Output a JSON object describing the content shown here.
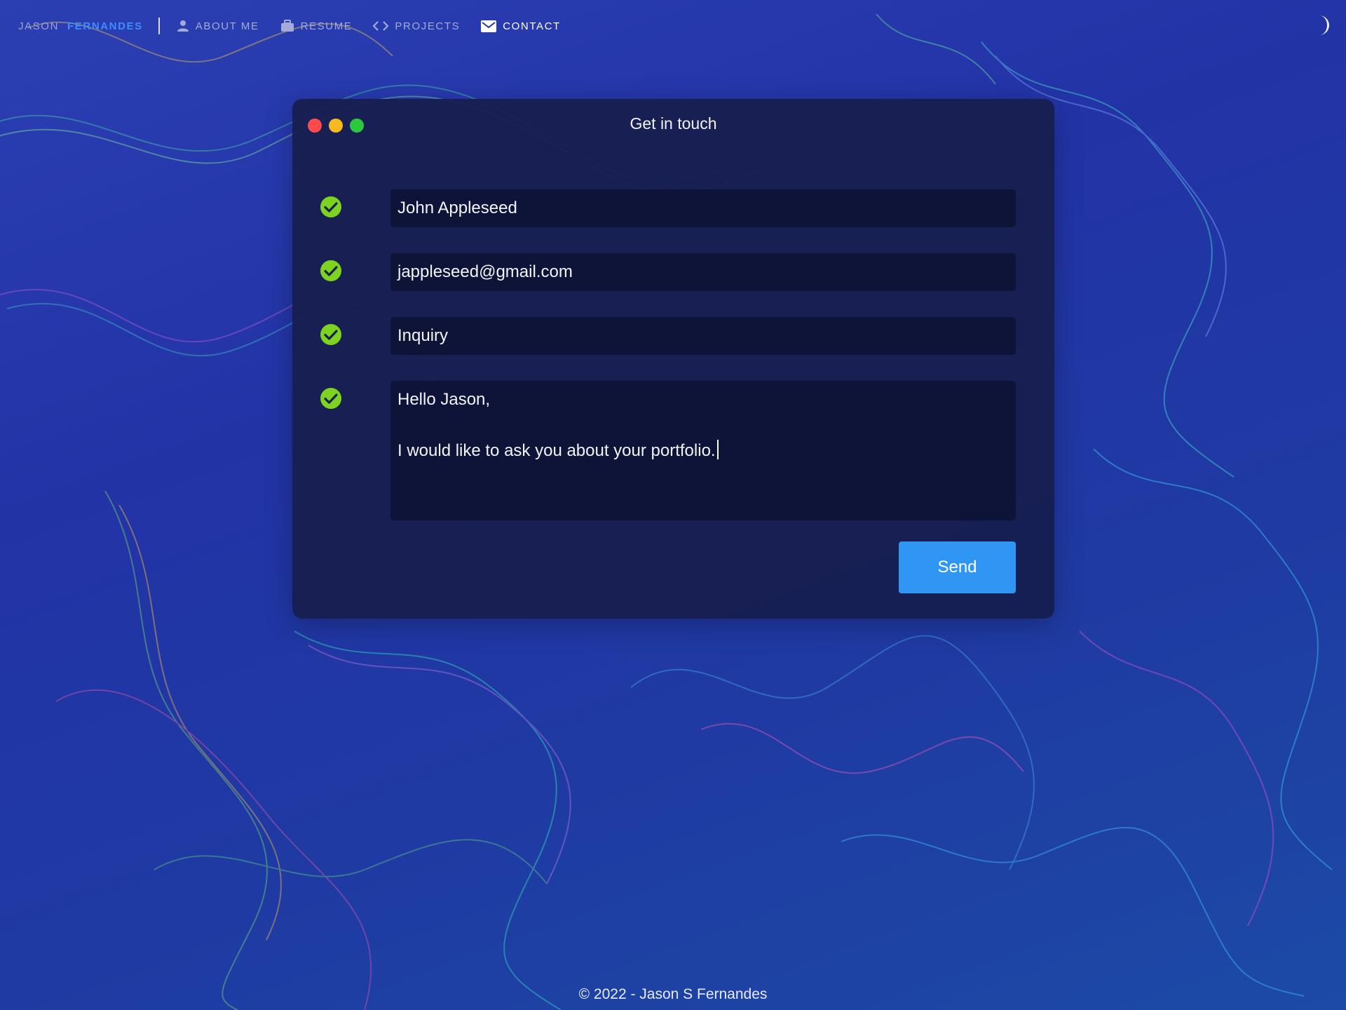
{
  "nav": {
    "brand_first": "JASON",
    "brand_last": "FERNANDES",
    "items": [
      {
        "label": "ABOUT ME",
        "icon": "person-icon"
      },
      {
        "label": "RESUME",
        "icon": "briefcase-icon"
      },
      {
        "label": "PROJECTS",
        "icon": "code-icon"
      },
      {
        "label": "CONTACT",
        "icon": "envelope-icon",
        "active": true
      }
    ],
    "theme_toggle_icon": "moon-icon"
  },
  "window": {
    "title": "Get in touch",
    "traffic_lights": {
      "close": "#ff4b4b",
      "minimize": "#f6b91e",
      "maximize": "#2dc840"
    },
    "fields": {
      "name": "John Appleseed",
      "email": "jappleseed@gmail.com",
      "subject": "Inquiry",
      "message_line1": "Hello Jason,",
      "message_line2": "I would like to ask you about your portfolio."
    },
    "valid_icon": "check-circle-icon",
    "send_label": "Send"
  },
  "footer": {
    "text": "© 2022 - Jason S Fernandes"
  },
  "colors": {
    "accent": "#2f97f3",
    "brand": "#3d8dff",
    "valid": "#7ed321"
  }
}
